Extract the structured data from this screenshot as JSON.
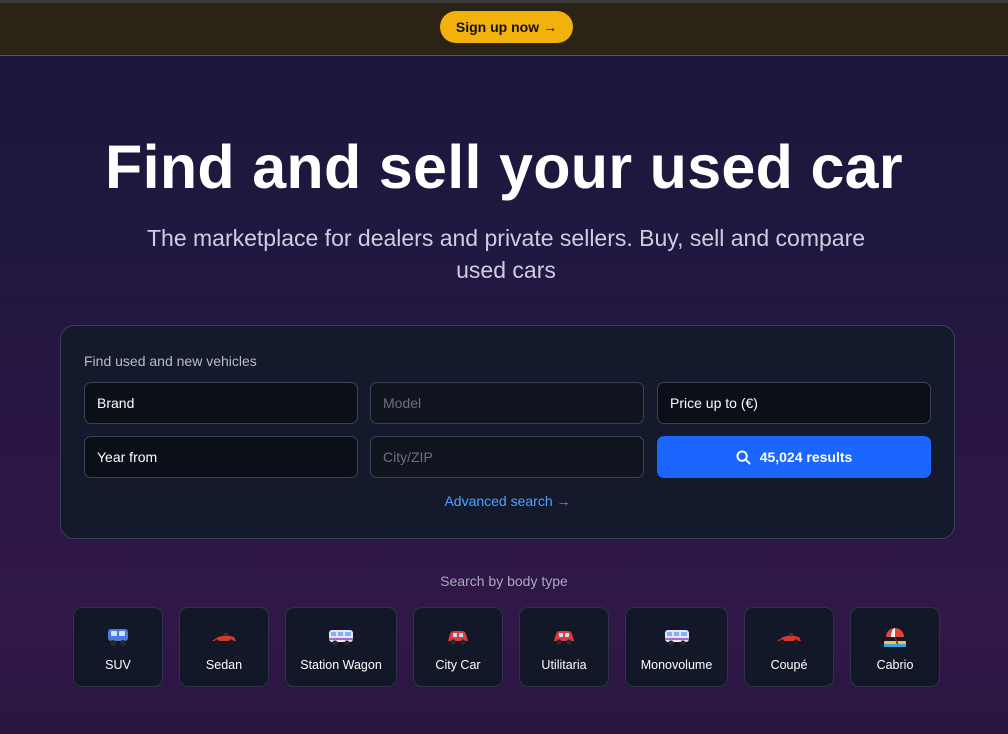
{
  "banner": {
    "signup_label": "Sign up now",
    "arrow": "→"
  },
  "hero": {
    "title": "Find and sell your used car",
    "subtitle": "The marketplace for dealers and private sellers. Buy, sell and compare used cars"
  },
  "search": {
    "heading": "Find used and new vehicles",
    "brand_label": "Brand",
    "model_placeholder": "Model",
    "price_label": "Price up to (€)",
    "year_label": "Year from",
    "city_placeholder": "City/ZIP",
    "results_label": "45,024 results",
    "advanced_label": "Advanced search →"
  },
  "body_types": {
    "heading": "Search by body type",
    "items": [
      {
        "label": "SUV",
        "icon": "suv-icon"
      },
      {
        "label": "Sedan",
        "icon": "race-car-icon"
      },
      {
        "label": "Station Wagon",
        "icon": "minibus-icon"
      },
      {
        "label": "City Car",
        "icon": "car-icon"
      },
      {
        "label": "Utilitaria",
        "icon": "car-icon"
      },
      {
        "label": "Monovolume",
        "icon": "minibus-icon"
      },
      {
        "label": "Coupé",
        "icon": "race-car-icon"
      },
      {
        "label": "Cabrio",
        "icon": "beach-umbrella-icon"
      }
    ]
  },
  "colors": {
    "accent_yellow": "#f3b10b",
    "primary_blue": "#1a66ff",
    "link_blue": "#4ea3ff"
  }
}
